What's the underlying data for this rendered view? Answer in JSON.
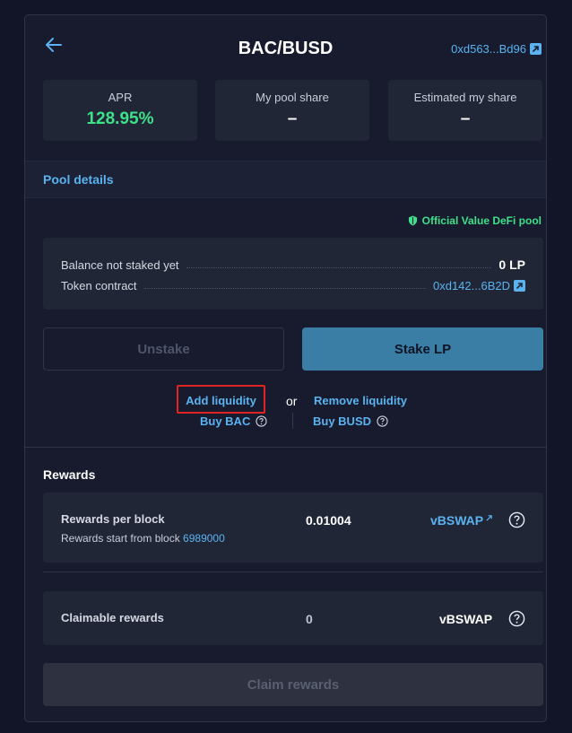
{
  "header": {
    "title": "BAC/BUSD",
    "pair_address": "0xd563...Bd96"
  },
  "stats": [
    {
      "label": "APR",
      "value": "128.95%"
    },
    {
      "label": "My pool share",
      "value": "–"
    },
    {
      "label": "Estimated my share",
      "value": "–"
    }
  ],
  "pool": {
    "section_title": "Pool details",
    "official_badge": "Official Value DeFi pool",
    "balance_label": "Balance not staked yet",
    "balance_value": "0 LP",
    "token_contract_label": "Token contract",
    "token_contract_value": "0xd142...6B2D"
  },
  "actions": {
    "unstake_label": "Unstake",
    "stake_label": "Stake LP",
    "add_liquidity": "Add liquidity",
    "or_text": "or",
    "remove_liquidity": "Remove liquidity",
    "buy_bac": "Buy BAC",
    "buy_busd": "Buy BUSD"
  },
  "rewards": {
    "title": "Rewards",
    "per_block_label": "Rewards per block",
    "start_text": "Rewards start from block",
    "start_block": "6989000",
    "per_block_value": "0.01004",
    "per_block_token": "vBSWAP",
    "claimable_label": "Claimable rewards",
    "claimable_value": "0",
    "claimable_token": "vBSWAP",
    "claim_button": "Claim rewards"
  },
  "colors": {
    "accent": "#5ab3f0",
    "green": "#3ee08a",
    "highlight": "#e02424"
  }
}
